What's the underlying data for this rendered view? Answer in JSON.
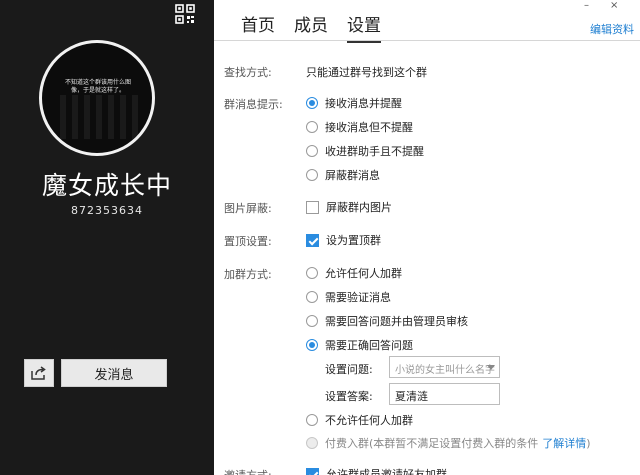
{
  "left": {
    "avatar_caption": "不知道这个群该用什么图\n像，于是就这样了。",
    "group_name": "魔女成长中",
    "group_id": "872353634",
    "send_label": "发消息"
  },
  "window": {
    "minimize": "–",
    "close": "×"
  },
  "tabs": [
    {
      "label": "首页"
    },
    {
      "label": "成员"
    },
    {
      "label": "设置"
    }
  ],
  "edit_link": "编辑资料",
  "settings": {
    "find": {
      "label": "查找方式:",
      "value": "只能通过群号找到这个群"
    },
    "notify": {
      "label": "群消息提示:",
      "options": [
        "接收消息并提醒",
        "接收消息但不提醒",
        "收进群助手且不提醒",
        "屏蔽群消息"
      ]
    },
    "image": {
      "label": "图片屏蔽:",
      "option": "屏蔽群内图片"
    },
    "pin": {
      "label": "置顶设置:",
      "option": "设为置顶群"
    },
    "join": {
      "label": "加群方式:",
      "options": [
        "允许任何人加群",
        "需要验证消息",
        "需要回答问题并由管理员审核",
        "需要正确回答问题",
        "不允许任何人加群"
      ],
      "question_label": "设置问题:",
      "question_value": "小说的女主叫什么名字",
      "answer_label": "设置答案:",
      "answer_value": "夏清涟",
      "paid_text": "付费入群(本群暂不满足设置付费入群的条件",
      "paid_link": "了解详情",
      "paid_close": ")"
    },
    "invite": {
      "label": "邀请方式:",
      "option": "允许群成员邀请好友加群"
    }
  },
  "colors": {
    "accent": "#2a8ce0",
    "link": "#1f7fd1",
    "panel": "#1a1a1a"
  }
}
